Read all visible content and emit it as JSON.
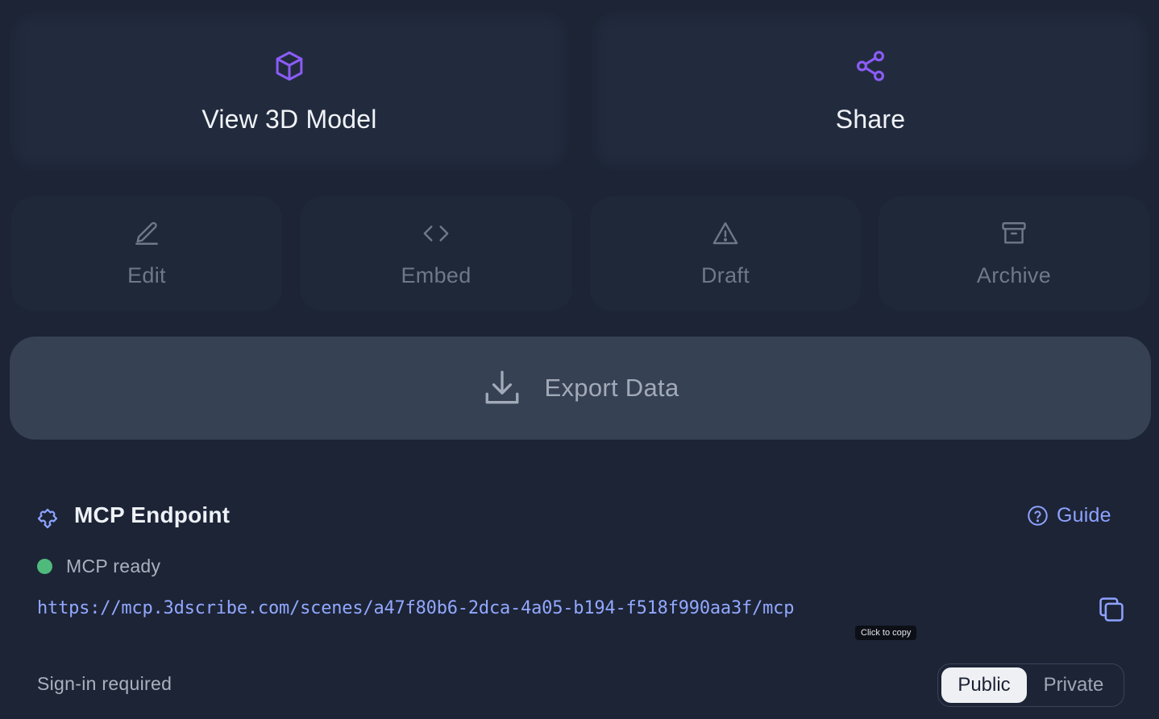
{
  "actions": {
    "view_model": "View 3D Model",
    "share": "Share",
    "edit": "Edit",
    "embed": "Embed",
    "draft": "Draft",
    "archive": "Archive",
    "export": "Export Data"
  },
  "icons": {
    "view_model": "cube-icon",
    "share": "share-icon",
    "edit": "pencil-icon",
    "embed": "code-icon",
    "draft": "warning-icon",
    "archive": "archive-icon",
    "export": "download-icon",
    "mcp": "puzzle-icon",
    "guide": "help-circle-icon",
    "copy": "copy-icon"
  },
  "mcp": {
    "title": "MCP Endpoint",
    "guide": "Guide",
    "status": "MCP ready",
    "url": "https://mcp.3dscribe.com/scenes/a47f80b6-2dca-4a05-b194-f518f990aa3f/mcp",
    "copy_tooltip": "Click to copy",
    "signin_note": "Sign-in required",
    "visibility": {
      "options": [
        "Public",
        "Private"
      ],
      "selected": "Public"
    }
  },
  "colors": {
    "background": "#1c2436",
    "accent_purple": "#8b5cf6",
    "link_blue": "#93a8ff",
    "status_green": "#4fba7c"
  }
}
